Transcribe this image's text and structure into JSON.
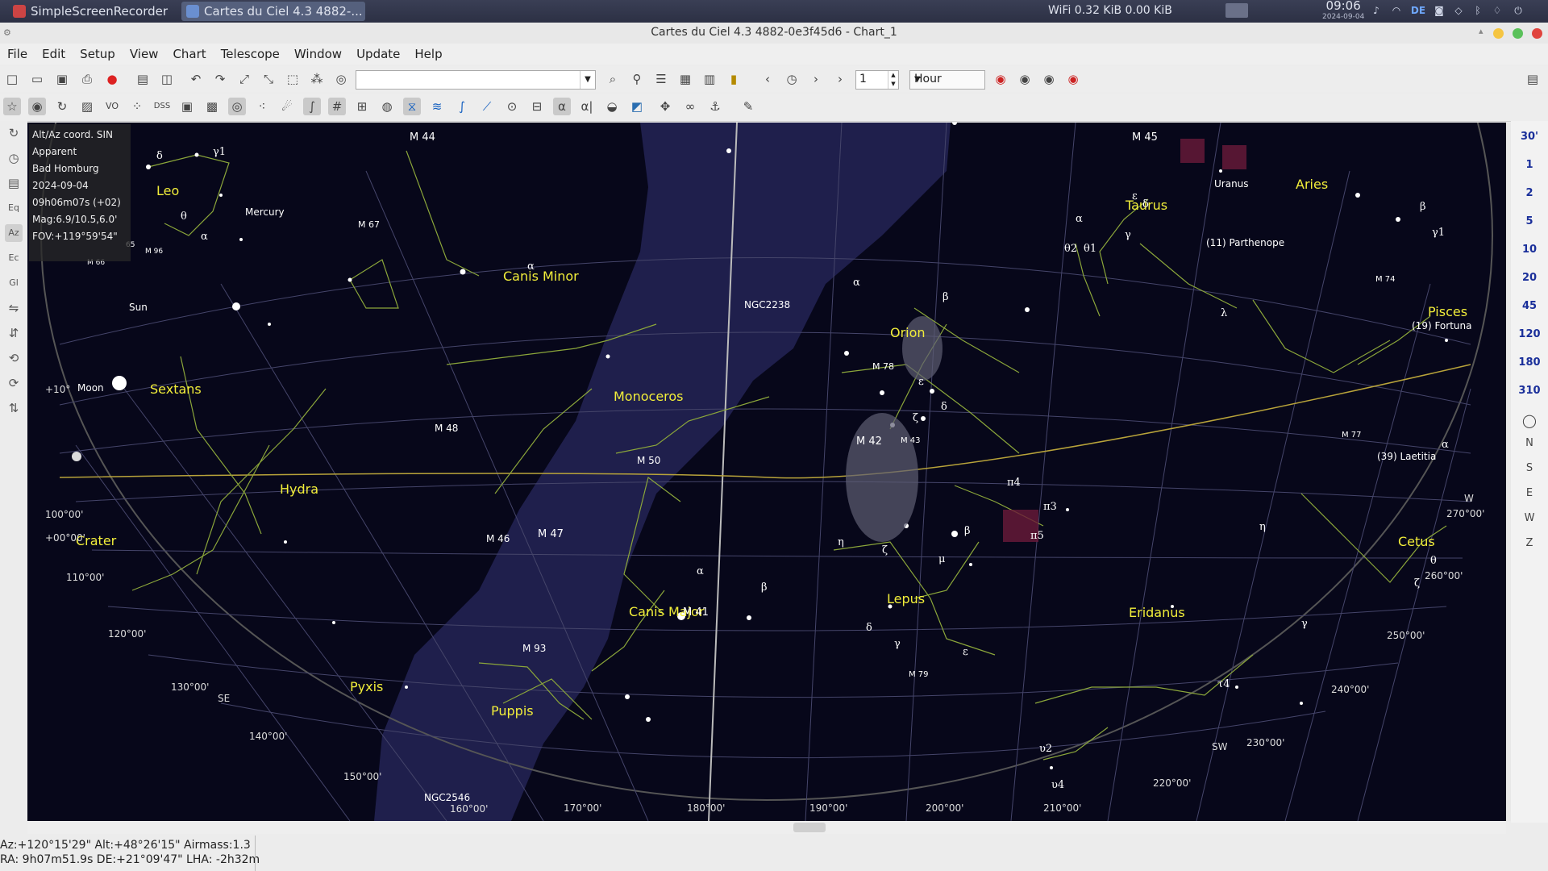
{
  "taskbar": {
    "task1": "SimpleScreenRecorder",
    "task2": "Cartes du Ciel 4.3 4882-...",
    "wifi": "WiFi 0.32 KiB 0.00 KiB",
    "time": "09:06",
    "date": "2024-09-04",
    "keyboard": "DE"
  },
  "window": {
    "title": "Cartes du Ciel 4.3 4882-0e3f45d6 - Chart_1"
  },
  "menu": [
    "File",
    "Edit",
    "Setup",
    "View",
    "Chart",
    "Telescope",
    "Window",
    "Update",
    "Help"
  ],
  "toolbar": {
    "search_value": "",
    "step_value": "1",
    "unit_value": "Hour",
    "vo_label": "VO",
    "dss_label": "DSS"
  },
  "info": {
    "projection": "Alt/Az coord. SIN",
    "mode": "Apparent",
    "location": "Bad Homburg",
    "date": "2024-09-04",
    "time": "09h06m07s (+02)",
    "mag": "Mag:6.9/10.5,6.0'",
    "fov": "FOV:+119°59'54\""
  },
  "fov_buttons": [
    "30'",
    "1",
    "2",
    "5",
    "10",
    "20",
    "45",
    "120",
    "180",
    "310"
  ],
  "direction_buttons": [
    "N",
    "S",
    "E",
    "W",
    "Z"
  ],
  "constellations": [
    "Leo",
    "Canis Minor",
    "Sextans",
    "Monoceros",
    "Hydra",
    "Crater",
    "Pyxis",
    "Puppis",
    "Canis Major",
    "Lepus",
    "Orion",
    "Taurus",
    "Aries",
    "Eridanus",
    "Cetus",
    "Pisces"
  ],
  "objects": [
    "M 44",
    "M 67",
    "Mercury",
    "Sun",
    "Moon",
    "M 66",
    "M 96",
    "65",
    "M 48",
    "M 50",
    "M 46",
    "M 47",
    "M 41",
    "M 93",
    "NGC2546",
    "NGC2238",
    "M 78",
    "M 42",
    "M 43",
    "M 79",
    "M 45",
    "Uranus",
    "(11) Parthenope",
    "M 74",
    "(19) Fortuna",
    "M 77",
    "(39) Laetitia"
  ],
  "grid_labels": [
    "+10°",
    "100°00'",
    "+00°00'",
    "110°00'",
    "120°00'",
    "130°00'",
    "140°00'",
    "150°00'",
    "160°00'",
    "170°00'",
    "180°00'",
    "190°00'",
    "200°00'",
    "210°00'",
    "220°00'",
    "230°00'",
    "240°00'",
    "250°00'",
    "260°00'",
    "270°00'"
  ],
  "horizon_labels": [
    "SE",
    "SW",
    "W"
  ],
  "status": {
    "line1": "Az:+120°15'29\" Alt:+48°26'15\" Airmass:1.3",
    "line2": "RA:  9h07m51.9s DE:+21°09'47\" LHA: -2h32m"
  }
}
